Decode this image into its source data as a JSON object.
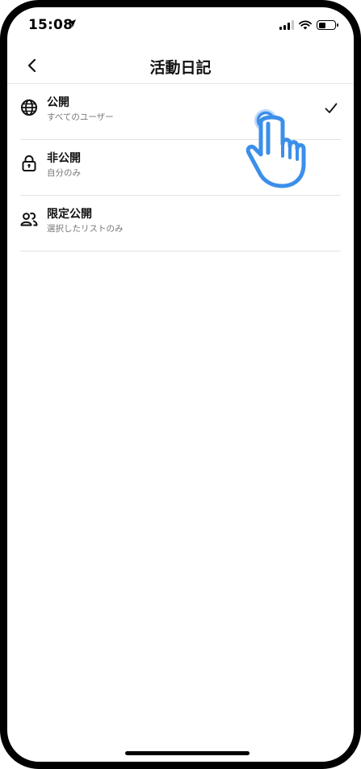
{
  "status_bar": {
    "time": "15:08"
  },
  "nav": {
    "title": "活動日記"
  },
  "options": [
    {
      "title": "公開",
      "subtitle": "すべてのユーザー",
      "icon": "globe-icon",
      "selected": true
    },
    {
      "title": "非公開",
      "subtitle": "自分のみ",
      "icon": "lock-icon",
      "selected": false
    },
    {
      "title": "限定公開",
      "subtitle": "選択したリストのみ",
      "icon": "users-icon",
      "selected": false
    }
  ],
  "colors": {
    "accent": "#3b8fea",
    "text": "#111111",
    "subtext": "#777777",
    "divider": "#e3e3e3"
  }
}
